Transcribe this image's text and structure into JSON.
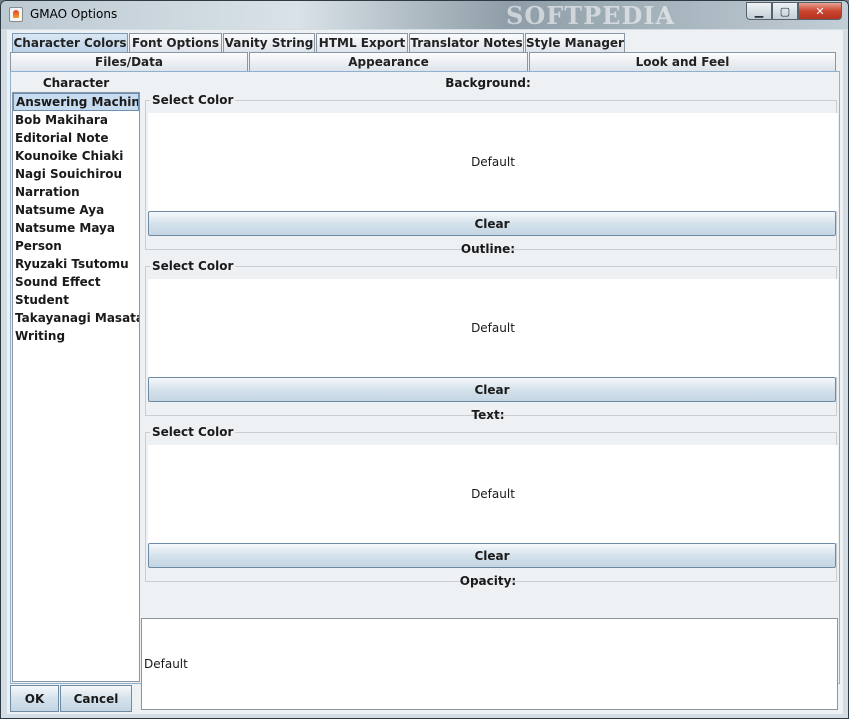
{
  "window": {
    "title": "GMAO Options",
    "watermark": "SOFTPEDIA",
    "minimize_label": "▁",
    "maximize_label": "▢",
    "close_label": "✕"
  },
  "tabs_row1": [
    {
      "label": "Character Colors",
      "active": true
    },
    {
      "label": "Font Options",
      "active": false
    },
    {
      "label": "Vanity String",
      "active": false
    },
    {
      "label": "HTML Export",
      "active": false
    },
    {
      "label": "Translator Notes",
      "active": false
    },
    {
      "label": "Style Manager",
      "active": false
    }
  ],
  "tabs_row2": [
    {
      "label": "Files/Data"
    },
    {
      "label": "Appearance"
    },
    {
      "label": "Look and Feel"
    }
  ],
  "character_panel": {
    "header": "Character",
    "items": [
      "Answering Machine",
      "Bob Makihara",
      "Editorial Note",
      "Kounoike Chiaki",
      "Nagi Souichirou",
      "Narration",
      "Natsume Aya",
      "Natsume Maya",
      "Person",
      "Ryuzaki Tsutomu",
      "Sound Effect",
      "Student",
      "Takayanagi Masataka",
      "Writing"
    ],
    "selected_index": 0
  },
  "sections": {
    "background": {
      "label": "Background:",
      "legend": "Select Color",
      "value": "Default",
      "clear_label": "Clear"
    },
    "outline": {
      "label": "Outline:",
      "legend": "Select Color",
      "value": "Default",
      "clear_label": "Clear"
    },
    "text": {
      "label": "Text:",
      "legend": "Select Color",
      "value": "Default",
      "clear_label": "Clear"
    },
    "opacity": {
      "label": "Opacity:",
      "value": "Default"
    }
  },
  "buttons": {
    "ok": "OK",
    "cancel": "Cancel"
  }
}
